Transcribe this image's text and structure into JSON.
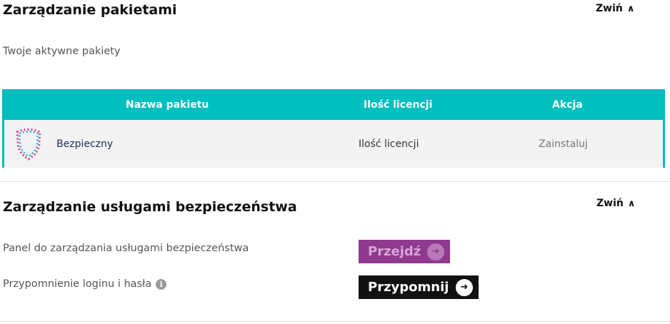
{
  "packages": {
    "title": "Zarządzanie pakietami",
    "collapse_label": "Zwiń",
    "subtitle": "Twoje aktywne pakiety",
    "table": {
      "columns": [
        "Nazwa pakietu",
        "Ilość licencji",
        "Akcja"
      ],
      "rows": [
        {
          "icon": "shield-icon",
          "name": "Bezpieczny",
          "licenses": "Ilość licencji",
          "action": "Zainstaluj"
        }
      ]
    }
  },
  "security": {
    "title": "Zarządzanie usługami bezpieczeństwa",
    "collapse_label": "Zwiń",
    "panel_label": "Panel do zarządzania usługami bezpieczeństwa",
    "panel_button": "Przejdź",
    "reminder_label": "Przypomnienie loginu i hasła",
    "reminder_button": "Przypomnij"
  },
  "colors": {
    "table_header": "#00bfbf",
    "panel_button": "#8f3a8f",
    "reminder_button": "#111111"
  }
}
